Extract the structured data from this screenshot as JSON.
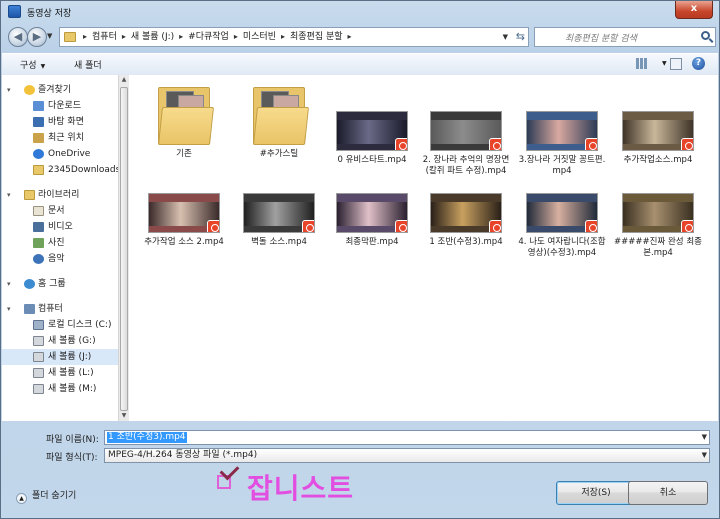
{
  "window": {
    "title": "동영상 저장",
    "close_label": "x"
  },
  "address": {
    "crumbs": [
      "컴퓨터",
      "새 볼륨 (J:)",
      "#다큐작업",
      "미스터빈",
      "최종편집 분할"
    ],
    "search_placeholder": "최종편집 분할 검색"
  },
  "toolbar": {
    "organize": "구성",
    "new_folder": "새 폴더",
    "help": "?"
  },
  "nav": {
    "favorites": {
      "label": "즐겨찾기",
      "items": [
        "다운로드",
        "바탕 화면",
        "최근 위치",
        "OneDrive",
        "2345Downloads"
      ]
    },
    "libraries": {
      "label": "라이브러리",
      "items": [
        "문서",
        "비디오",
        "사진",
        "음악"
      ]
    },
    "homegroup": "홈 그룹",
    "computer": {
      "label": "컴퓨터",
      "items": [
        "로컬 디스크 (C:)",
        "새 볼륨 (G:)",
        "새 볼륨 (J:)",
        "새 볼륨 (L:)",
        "새 볼륨 (M:)"
      ]
    }
  },
  "files": [
    {
      "name": "기존",
      "kind": "folder"
    },
    {
      "name": "#추가스틸",
      "kind": "folder"
    },
    {
      "name": "0 유비스타트.mp4",
      "kind": "video"
    },
    {
      "name": "2. 장나라 추억의 명장면 (칼쥐 파트 수정).mp4",
      "kind": "video"
    },
    {
      "name": "3.장나라 거짓말 꽁트편.mp4",
      "kind": "video"
    },
    {
      "name": "추가작업소스.mp4",
      "kind": "video"
    },
    {
      "name": "추가작업 소스 2.mp4",
      "kind": "video"
    },
    {
      "name": "벽돌 소스.mp4",
      "kind": "video"
    },
    {
      "name": "최종막판.mp4",
      "kind": "video"
    },
    {
      "name": "1 조반(수정3).mp4",
      "kind": "video"
    },
    {
      "name": "4. 나도 여자랍니다(조합영상)(수정3).mp4",
      "kind": "video"
    },
    {
      "name": "#####진짜 완성 최종본.mp4",
      "kind": "video"
    }
  ],
  "form": {
    "filename_label": "파일 이름(N):",
    "filename_value": "1 조반(수정3).mp4",
    "filetype_label": "파일 형식(T):",
    "filetype_value": "MPEG-4/H.264 동영상 파일 (*.mp4)",
    "hide_folders": "폴더 숨기기",
    "save": "저장(S)",
    "cancel": "취소"
  },
  "overlay": {
    "text": "잡니스트"
  }
}
